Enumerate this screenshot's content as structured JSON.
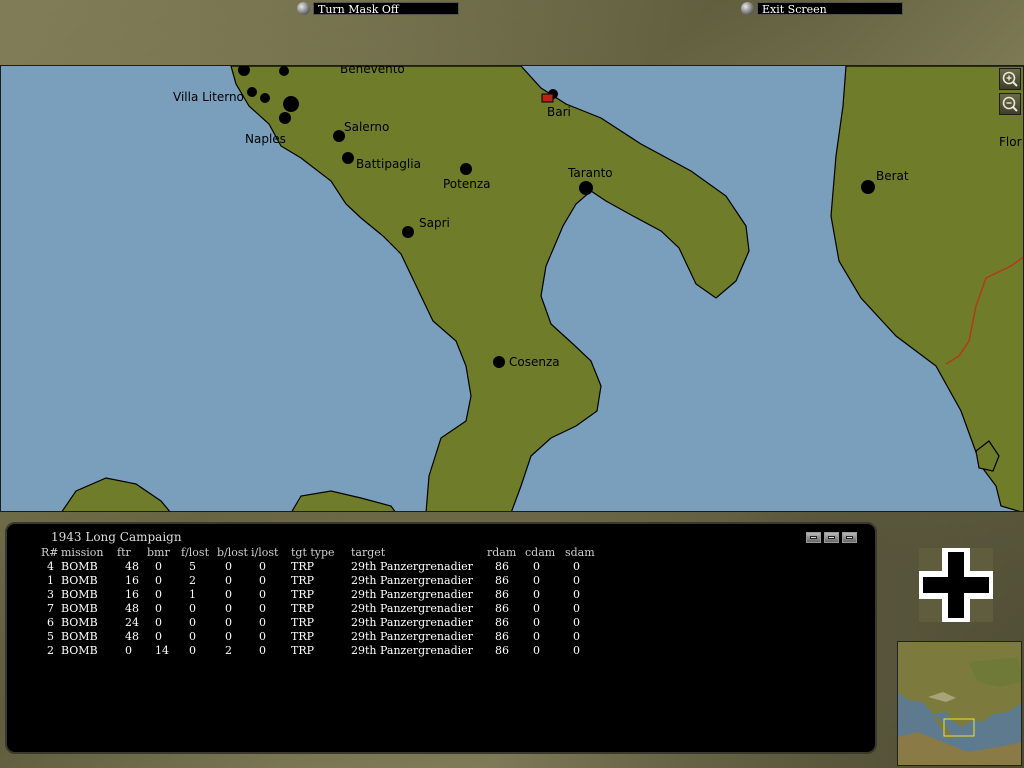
{
  "topbar": {
    "turn_mask_label": "Turn Mask Off",
    "exit_label": "Exit Screen"
  },
  "map": {
    "cities": [
      {
        "name": "Benevento"
      },
      {
        "name": "Villa Literno"
      },
      {
        "name": "Naples"
      },
      {
        "name": "Salerno"
      },
      {
        "name": "Battipaglia"
      },
      {
        "name": "Potenza"
      },
      {
        "name": "Bari"
      },
      {
        "name": "Taranto"
      },
      {
        "name": "Sapri"
      },
      {
        "name": "Cosenza"
      },
      {
        "name": "Berat"
      },
      {
        "name": "Flor"
      }
    ],
    "colors": {
      "sea": "#7a9fbd",
      "land": "#6f7d2a",
      "border": "#b23a1a"
    }
  },
  "panel": {
    "title": "1943 Long Campaign",
    "headers": [
      "R#",
      "mission",
      "ftr",
      "bmr",
      "f/lost",
      "b/lost",
      "i/lost",
      "tgt type",
      "target",
      "rdam",
      "cdam",
      "sdam"
    ],
    "rows": [
      [
        "4",
        "BOMB",
        "48",
        "0",
        "5",
        "0",
        "0",
        "TRP",
        "29th Panzergrenadier",
        "86",
        "0",
        "0"
      ],
      [
        "1",
        "BOMB",
        "16",
        "0",
        "2",
        "0",
        "0",
        "TRP",
        "29th Panzergrenadier",
        "86",
        "0",
        "0"
      ],
      [
        "3",
        "BOMB",
        "16",
        "0",
        "1",
        "0",
        "0",
        "TRP",
        "29th Panzergrenadier",
        "86",
        "0",
        "0"
      ],
      [
        "7",
        "BOMB",
        "48",
        "0",
        "0",
        "0",
        "0",
        "TRP",
        "29th Panzergrenadier",
        "86",
        "0",
        "0"
      ],
      [
        "6",
        "BOMB",
        "24",
        "0",
        "0",
        "0",
        "0",
        "TRP",
        "29th Panzergrenadier",
        "86",
        "0",
        "0"
      ],
      [
        "5",
        "BOMB",
        "48",
        "0",
        "0",
        "0",
        "0",
        "TRP",
        "29th Panzergrenadier",
        "86",
        "0",
        "0"
      ],
      [
        "2",
        "BOMB",
        "0",
        "14",
        "0",
        "2",
        "0",
        "TRP",
        "29th Panzergrenadier",
        "86",
        "0",
        "0"
      ]
    ]
  },
  "icons": {
    "zoom_in": "zoom-in-icon",
    "zoom_out": "zoom-out-icon",
    "faction": "balkenkreuz-icon",
    "minimize": "minimize-icon",
    "restore": "restore-icon",
    "maximize": "maximize-icon"
  }
}
